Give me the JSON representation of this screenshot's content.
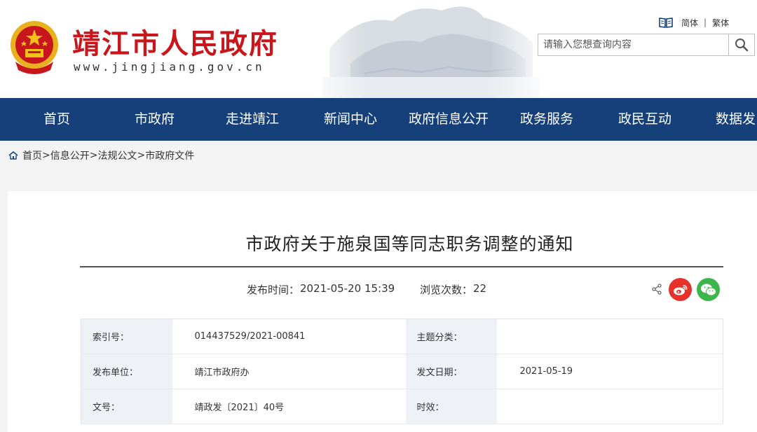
{
  "header": {
    "site_title": "靖江市人民政府",
    "site_url": "www.jingjiang.gov.cn",
    "lang_simplified": "简体",
    "lang_separator": "|",
    "lang_traditional": "繁体",
    "search_placeholder": "请输入您想查询内容"
  },
  "nav": {
    "items": [
      "首页",
      "市政府",
      "走进靖江",
      "新闻中心",
      "政府信息公开",
      "政务服务",
      "政民互动",
      "数据发"
    ]
  },
  "breadcrumb": {
    "home": "首页",
    "sep1": ">",
    "info": "信息公开",
    "sep2": ">",
    "regulation": "法规公文",
    "sep3": ">",
    "current": "市政府文件"
  },
  "article": {
    "title": "市政府关于施泉国等同志职务调整的通知",
    "publish_label": "发布时间：",
    "publish_time": "2021-05-20 15:39",
    "views_label": "浏览次数：",
    "views": "22"
  },
  "info_table": {
    "index_label": "索引号：",
    "index_value": "014437529/2021-00841",
    "topic_label": "主题分类：",
    "topic_value": "",
    "unit_label": "发布单位：",
    "unit_value": "靖江市政府办",
    "date_label": "发文日期：",
    "date_value": "2021-05-19",
    "docno_label": "文号：",
    "docno_value": "靖政发〔2021〕40号",
    "validity_label": "时效：",
    "validity_value": ""
  },
  "colors": {
    "brand_red": "#c8161d",
    "nav_blue": "#15407a",
    "weibo_red": "#e6322b",
    "wechat_green": "#3cb64a"
  },
  "icons": [
    "national-emblem-icon",
    "book-icon",
    "search-icon",
    "home-icon",
    "share-icon",
    "weibo-icon",
    "wechat-icon"
  ]
}
